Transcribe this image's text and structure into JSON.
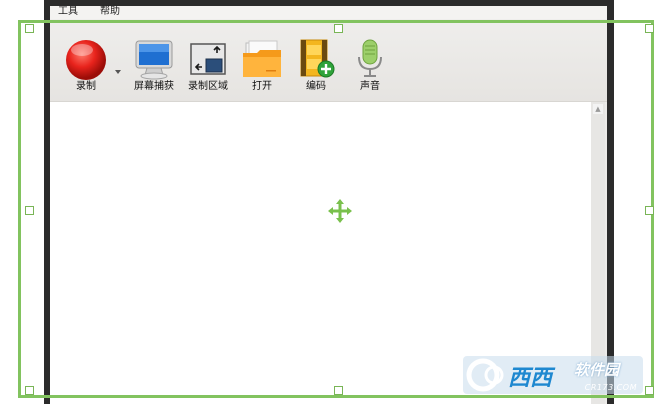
{
  "menu": {
    "items": [
      {
        "label": "工具"
      },
      {
        "label": "帮助"
      }
    ]
  },
  "toolbar": {
    "tools": [
      {
        "label": "录制",
        "icon": "record-icon"
      },
      {
        "label": "屏幕捕获",
        "icon": "monitor-icon"
      },
      {
        "label": "录制区域",
        "icon": "region-icon"
      },
      {
        "label": "打开",
        "icon": "folder-icon"
      },
      {
        "label": "编码",
        "icon": "film-add-icon"
      },
      {
        "label": "声音",
        "icon": "microphone-icon"
      }
    ],
    "record_dropdown_icon": "dropdown-arrow-icon"
  },
  "scrollbar": {
    "up_icon": "scroll-up-icon"
  },
  "selection": {
    "color": "#82c35f",
    "move_icon": "move-icon"
  },
  "watermark": {
    "logo_text": "西西",
    "side_text": "软件园",
    "url_text": "CR173.COM"
  },
  "colors": {
    "frame": "#2b2b2b",
    "toolbar_bg": "#ecebe9",
    "selection": "#82c35f"
  }
}
